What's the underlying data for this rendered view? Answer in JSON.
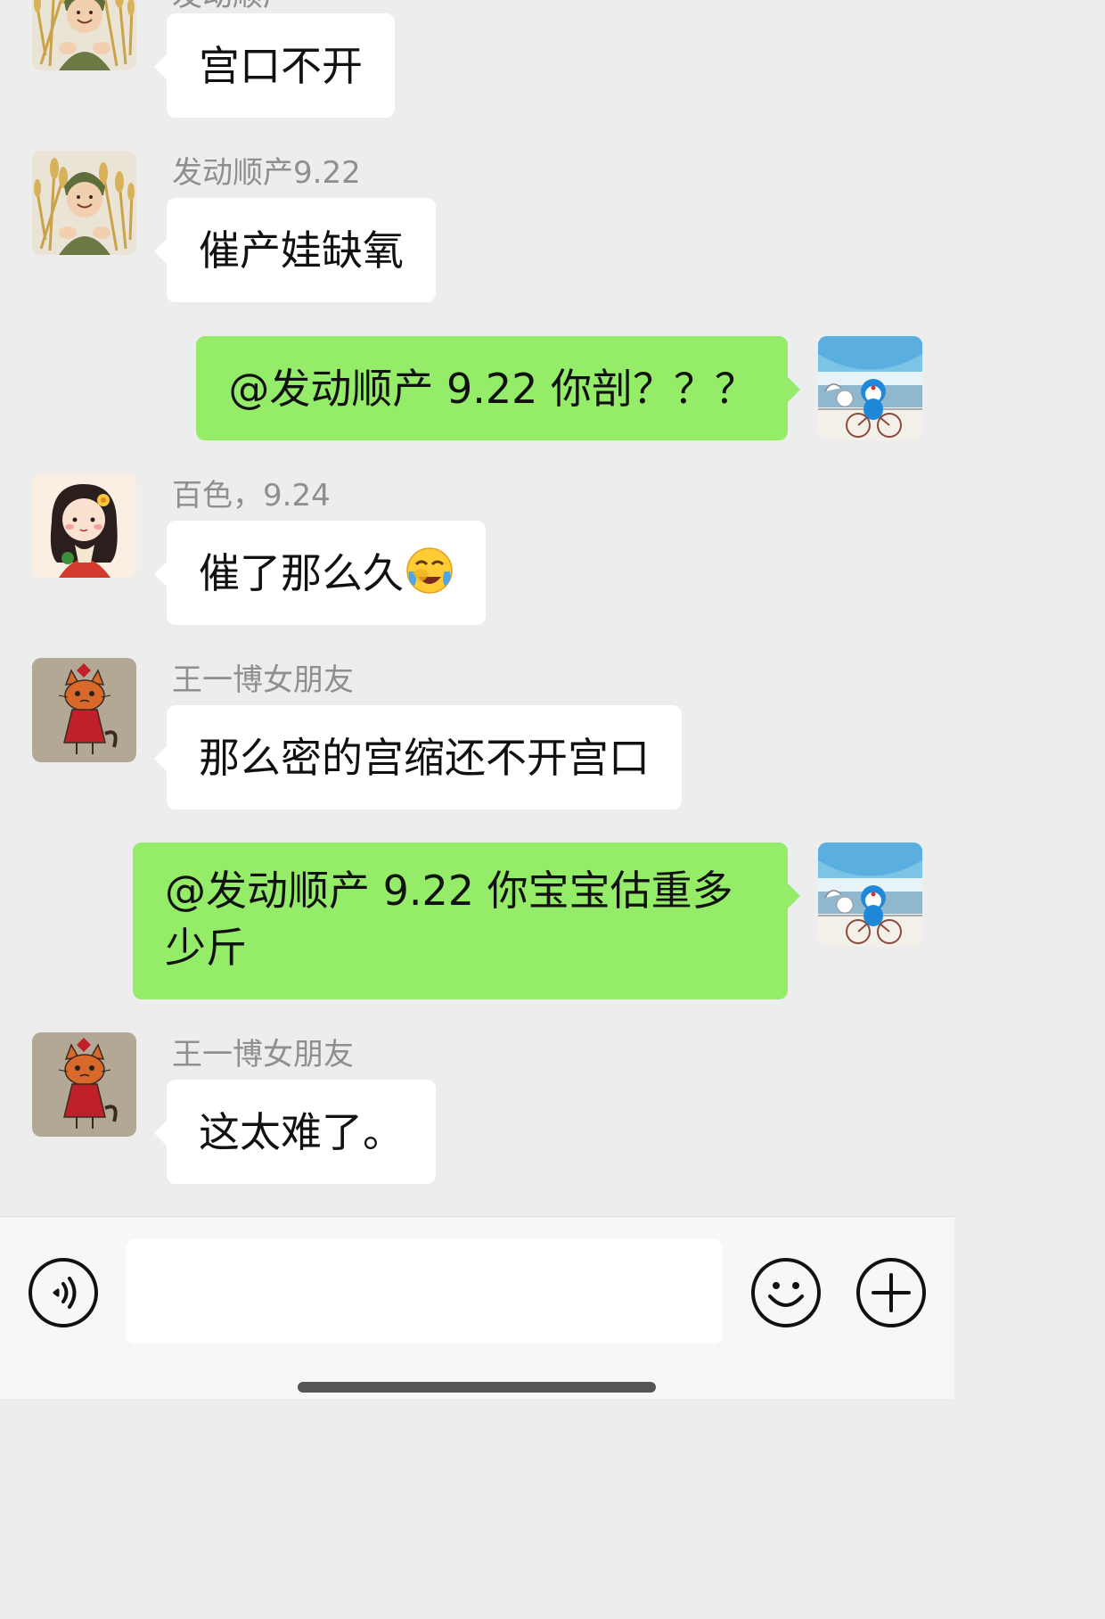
{
  "messages": [
    {
      "direction": "in",
      "sender": "发动顺产",
      "text": "宫口不开",
      "avatar": "wheat-girl-avatar"
    },
    {
      "direction": "in",
      "sender": "发动顺产9.22",
      "text": "催产娃缺氧",
      "avatar": "wheat-girl-avatar"
    },
    {
      "direction": "out",
      "text": "@发动顺产 9.22  你剖？？？",
      "avatar": "doraemon-bike-avatar"
    },
    {
      "direction": "in",
      "sender": "百色，9.24",
      "text": "催了那么久",
      "emoji": "face-with-tears-of-joy-icon",
      "avatar": "cartoon-girl-avatar"
    },
    {
      "direction": "in",
      "sender": "王一博女朋友",
      "text": "那么密的宫缩还不开宫口",
      "avatar": "cat-drawing-avatar"
    },
    {
      "direction": "out",
      "text": "@发动顺产 9.22  你宝宝估重多少斤",
      "avatar": "doraemon-bike-avatar"
    },
    {
      "direction": "in",
      "sender": "王一博女朋友",
      "text": "这太难了。",
      "avatar": "cat-drawing-avatar"
    }
  ],
  "input": {
    "value": "",
    "placeholder": ""
  },
  "toolbar": {
    "voice_icon": "voice-icon",
    "emoji_icon": "emoji-icon",
    "plus_icon": "plus-icon"
  },
  "colors": {
    "background": "#ededed",
    "incoming_bubble": "#ffffff",
    "outgoing_bubble": "#95ec69",
    "sender_name": "#8f8f8f"
  }
}
